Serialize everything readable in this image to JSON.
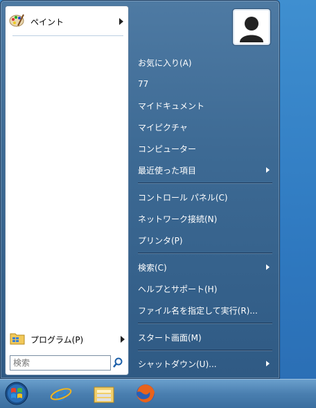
{
  "start_menu": {
    "pinned": [
      {
        "label": "ペイント",
        "icon": "paint-icon"
      }
    ],
    "programs_label": "プログラム(P)",
    "search": {
      "placeholder": "検索"
    },
    "right_items": [
      {
        "label": "お気に入り(A)",
        "submenu": false
      },
      {
        "label": "77",
        "submenu": false
      },
      {
        "label": "マイドキュメント",
        "submenu": false
      },
      {
        "label": "マイピクチャ",
        "submenu": false
      },
      {
        "label": "コンピューター",
        "submenu": false
      },
      {
        "label": "最近使った項目",
        "submenu": true
      },
      {
        "label": "コントロール パネル(C)",
        "submenu": false
      },
      {
        "label": "ネットワーク接続(N)",
        "submenu": false
      },
      {
        "label": "プリンタ(P)",
        "submenu": false
      },
      {
        "label": "検索(C)",
        "submenu": true
      },
      {
        "label": "ヘルプとサポート(H)",
        "submenu": false
      },
      {
        "label": "ファイル名を指定して実行(R)...",
        "submenu": false
      },
      {
        "label": "スタート画面(M)",
        "submenu": false
      },
      {
        "label": "シャットダウン(U)...",
        "submenu": true
      }
    ]
  },
  "taskbar": {
    "buttons": [
      "start-orb-icon",
      "internet-explorer-icon",
      "file-explorer-icon",
      "firefox-icon"
    ]
  },
  "colors": {
    "menu_blue": "#3d6a94",
    "taskbar_blue": "#4a7fb0"
  }
}
